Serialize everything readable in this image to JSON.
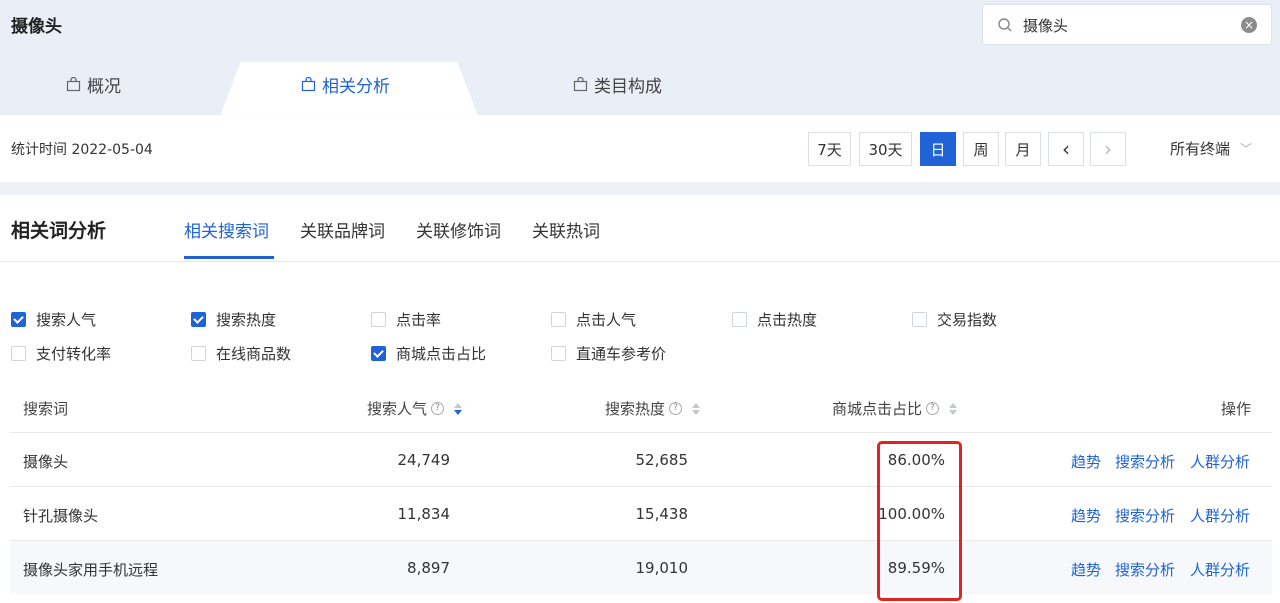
{
  "header": {
    "title": "摄像头",
    "search_value": "摄像头",
    "tabs": [
      {
        "label": "概况"
      },
      {
        "label": "相关分析"
      },
      {
        "label": "类目构成"
      }
    ]
  },
  "toolbar": {
    "stat_time": "统计时间 2022-05-04",
    "periods": [
      "7天",
      "30天",
      "日",
      "周",
      "月"
    ],
    "selected_period": "日",
    "prev": "‹",
    "next": "›",
    "terminal": "所有终端"
  },
  "section": {
    "title": "相关词分析",
    "subtabs": [
      "相关搜索词",
      "关联品牌词",
      "关联修饰词",
      "关联热词"
    ],
    "active_subtab": "相关搜索词"
  },
  "metrics": [
    {
      "label": "搜索人气",
      "checked": true
    },
    {
      "label": "搜索热度",
      "checked": true
    },
    {
      "label": "点击率",
      "checked": false
    },
    {
      "label": "点击人气",
      "checked": false
    },
    {
      "label": "点击热度",
      "checked": false
    },
    {
      "label": "交易指数",
      "checked": false
    },
    {
      "label": "支付转化率",
      "checked": false
    },
    {
      "label": "在线商品数",
      "checked": false
    },
    {
      "label": "商城点击占比",
      "checked": true
    },
    {
      "label": "直通车参考价",
      "checked": false
    }
  ],
  "table": {
    "columns": [
      "搜索词",
      "搜索人气",
      "搜索热度",
      "商城点击占比",
      "操作"
    ],
    "rows": [
      {
        "keyword": "摄像头",
        "popularity": "24,749",
        "heat": "52,685",
        "mall_ratio": "86.00%"
      },
      {
        "keyword": "针孔摄像头",
        "popularity": "11,834",
        "heat": "15,438",
        "mall_ratio": "100.00%"
      },
      {
        "keyword": "摄像头家用手机远程",
        "popularity": "8,897",
        "heat": "19,010",
        "mall_ratio": "89.59%"
      }
    ],
    "actions": [
      "趋势",
      "搜索分析",
      "人群分析"
    ]
  },
  "colors": {
    "accent": "#1f63d6",
    "highlight": "#e02424"
  }
}
